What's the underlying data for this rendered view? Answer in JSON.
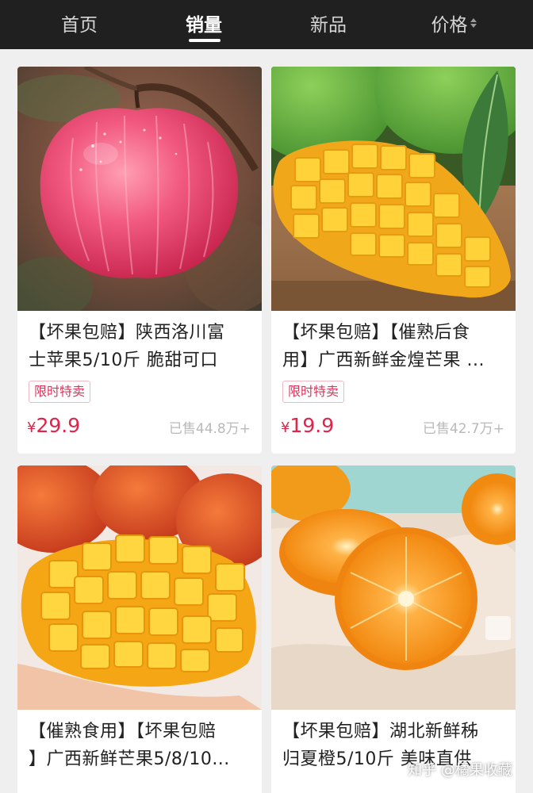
{
  "tabs": [
    {
      "label": "首页",
      "active": false
    },
    {
      "label": "销量",
      "active": true
    },
    {
      "label": "新品",
      "active": false
    },
    {
      "label": "价格",
      "active": false,
      "sortable": true
    }
  ],
  "products": [
    {
      "title_lines": [
        "【坏果包赔】陕西洛川富",
        "士苹果5/10斤 脆甜可口"
      ],
      "badge": "限时特卖",
      "currency": "¥",
      "price": "29.9",
      "sold": "已售44.8万+",
      "image": "red-apple"
    },
    {
      "title_lines": [
        "【坏果包赔】【催熟后食",
        "用】广西新鲜金煌芒果 ..."
      ],
      "badge": "限时特卖",
      "currency": "¥",
      "price": "19.9",
      "sold": "已售42.7万+",
      "image": "cut-mango"
    },
    {
      "title_lines": [
        "【催熟食用】【坏果包赔",
        "】广西新鲜芒果5/8/10..."
      ],
      "image": "diced-mango-in-hand"
    },
    {
      "title_lines": [
        "【坏果包赔】湖北新鲜秭",
        "归夏橙5/10斤 美味直供"
      ],
      "image": "halved-oranges"
    }
  ],
  "watermark": "知乎 @橘果收藏",
  "colors": {
    "header_bg": "#202020",
    "price_red": "#e0244a",
    "badge_text": "#e0335a",
    "page_bg": "#efefef"
  }
}
